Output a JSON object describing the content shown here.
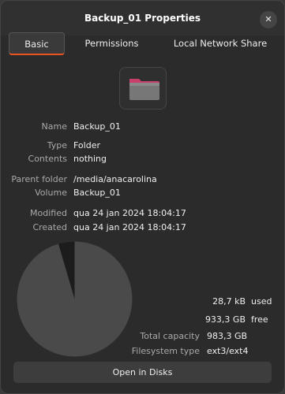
{
  "window": {
    "title": "Backup_01 Properties",
    "close_icon": "close-icon"
  },
  "tabs": [
    {
      "label": "Basic",
      "active": true
    },
    {
      "label": "Permissions",
      "active": false
    },
    {
      "label": "Local Network Share",
      "active": false
    }
  ],
  "folder_icon": "folder-icon",
  "info": {
    "name_label": "Name",
    "name_value": "Backup_01",
    "type_label": "Type",
    "type_value": "Folder",
    "contents_label": "Contents",
    "contents_value": "nothing",
    "parent_label": "Parent folder",
    "parent_value": "/media/anacarolina",
    "volume_label": "Volume",
    "volume_value": "Backup_01",
    "modified_label": "Modified",
    "modified_value": "qua 24 jan 2024 18:04:17",
    "created_label": "Created",
    "created_value": "qua 24 jan 2024 18:04:17"
  },
  "usage": {
    "used_amount": "28,7 kB",
    "used_label": "used",
    "free_amount": "933,3 GB",
    "free_label": "free",
    "total_label": "Total capacity",
    "total_value": "983,3 GB",
    "fs_label": "Filesystem type",
    "fs_value": "ext3/ext4"
  },
  "open_disks_label": "Open in Disks",
  "colors": {
    "accent": "#e95420",
    "pie_free": "#4a4a4a",
    "pie_used": "#1c1c1c"
  }
}
